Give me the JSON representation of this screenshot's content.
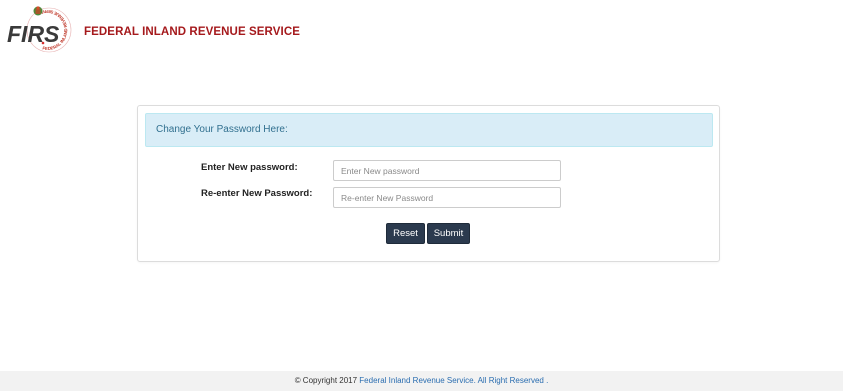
{
  "header": {
    "logo_text": "FIRS",
    "logo_ring_text": "FEDERAL INLAND REVENUE SERVICE",
    "title": "FEDERAL INLAND REVENUE SERVICE"
  },
  "panel": {
    "heading": "Change Your Password Here:",
    "fields": [
      {
        "label": "Enter New password:",
        "placeholder": "Enter New password",
        "value": ""
      },
      {
        "label": "Re-enter New Password:",
        "placeholder": "Re-enter New Password",
        "value": ""
      }
    ],
    "buttons": {
      "reset": "Reset",
      "submit": "Submit"
    }
  },
  "footer": {
    "copyright": "© Copyright 2017",
    "org_link": "Federal Inland Revenue Service. All Right Reserved ."
  },
  "colors": {
    "brand_red": "#a5191c",
    "heading_bg": "#d9edf7",
    "heading_text": "#31708f",
    "button_bg": "#2b3a4e",
    "link": "#2a6db0"
  },
  "icons": [
    "firs-logo-icon",
    "coat-of-arms-icon"
  ]
}
